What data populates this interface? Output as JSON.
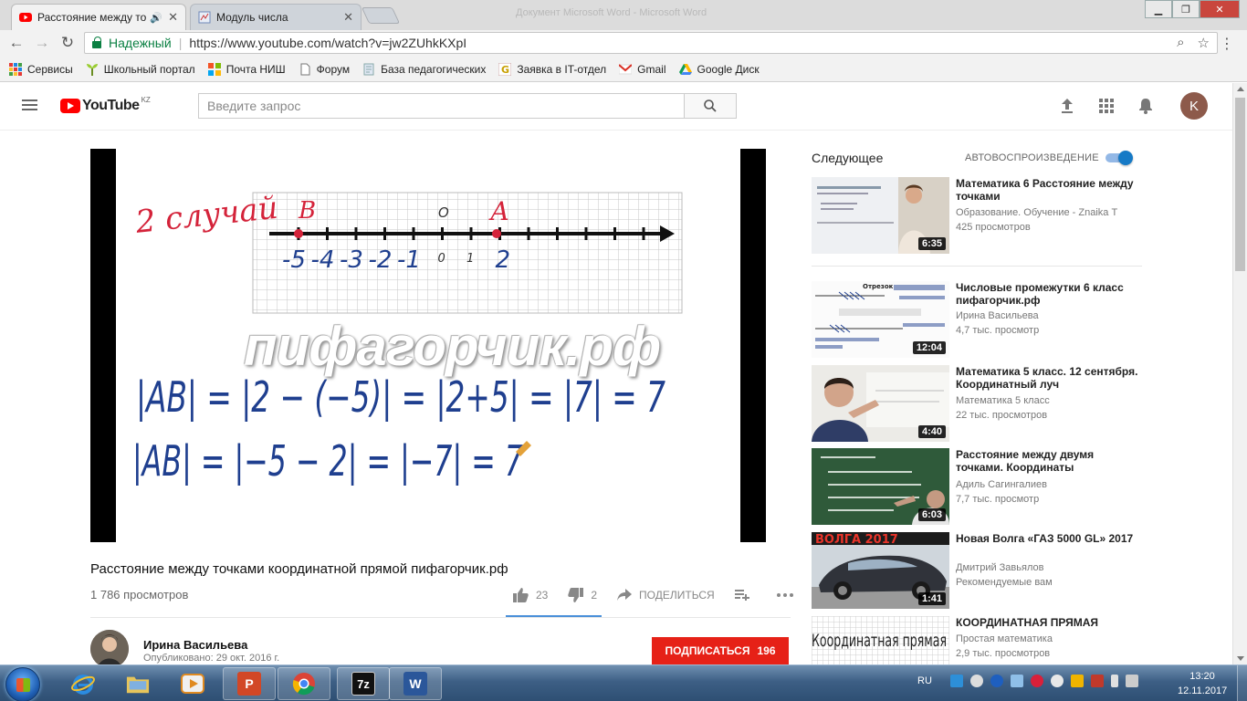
{
  "browser": {
    "tabs": [
      {
        "label": "Расстояние между то",
        "active": true
      },
      {
        "label": "Модуль числа",
        "active": false
      }
    ],
    "ghost_title": "Документ Microsoft Word - Microsoft Word",
    "secure_label": "Надежный",
    "url": "https://www.youtube.com/watch?v=jw2ZUhkKXpI",
    "bookmarks": [
      "Сервисы",
      "Школьный портал",
      "Почта НИШ",
      "Форум",
      "База педагогических",
      "Заявка в IT-отдел",
      "Gmail",
      "Google Диск"
    ]
  },
  "youtube": {
    "logo_word": "YouTube",
    "region": "KZ",
    "search_placeholder": "Введите запрос",
    "avatar_letter": "K"
  },
  "video": {
    "title": "Расстояние между точками координатной прямой пифагорчик.рф",
    "views": "1 786 просмотров",
    "likes": "23",
    "dislikes": "2",
    "share_label": "ПОДЕЛИТЬСЯ",
    "channel": "Ирина Васильева",
    "published": "Опубликовано: 29 окт. 2016 г.",
    "subscribe_label": "ПОДПИСАТЬСЯ",
    "subscribers": "196",
    "frame": {
      "case_label": "2 случай",
      "point_b": "В",
      "point_a": "А",
      "origin_mark": "О",
      "number_labels": [
        "-5",
        "-4",
        "-3",
        "-2",
        "-1",
        "0",
        "1",
        "2"
      ],
      "watermark": "пифагорчик.рф",
      "formula1": "|AB| = |2 − (−5)| = |2+5| = |7| = 7",
      "formula2": "|AB| = |−5 − 2| = |−7| = 7"
    }
  },
  "sidebar": {
    "next_label": "Следующее",
    "autoplay_label": "АВТОВОСПРОИЗВЕДЕНИЕ",
    "autoplay_on": true,
    "recommendations": [
      {
        "title": "Математика 6 Расстояние между точками",
        "channel": "Образование. Обучение - Znaika Т",
        "views": "425 просмотров",
        "duration": "6:35"
      },
      {
        "title": "Числовые промежутки 6 класс пифагорчик.рф",
        "channel": "Ирина Васильева",
        "views": "4,7 тыс. просмотр",
        "duration": "12:04"
      },
      {
        "title": "Математика 5 класс. 12 сентября. Координатный луч",
        "channel": "Математика 5 класс",
        "views": "22 тыс. просмотров",
        "duration": "4:40"
      },
      {
        "title": "Расстояние между двумя точками. Координаты",
        "channel": "Адиль Сагингалиев",
        "views": "7,7 тыс. просмотр",
        "duration": "6:03"
      },
      {
        "title": "Новая Волга «ГАЗ 5000 GL» 2017",
        "channel": "Дмитрий Завьялов",
        "views": "Рекомендуемые вам",
        "duration": "1:41"
      },
      {
        "title": "КООРДИНАТНАЯ ПРЯМАЯ",
        "channel": "Простая математика",
        "views": "2,9 тыс. просмотров",
        "duration": ""
      }
    ],
    "thumb_texts": {
      "t2_header": "Отрезок",
      "t5_banner": "ВОЛГА 2017",
      "t6_text": "Координатная прямая"
    }
  },
  "taskbar": {
    "language": "RU",
    "time": "13:20",
    "date": "12.11.2017"
  },
  "colors": {
    "yt_red": "#ff0000",
    "subscribe_red": "#e62117",
    "autoplay_blue": "#167ac6",
    "ink_blue": "#1f3f8f",
    "ink_red": "#d4233a"
  }
}
